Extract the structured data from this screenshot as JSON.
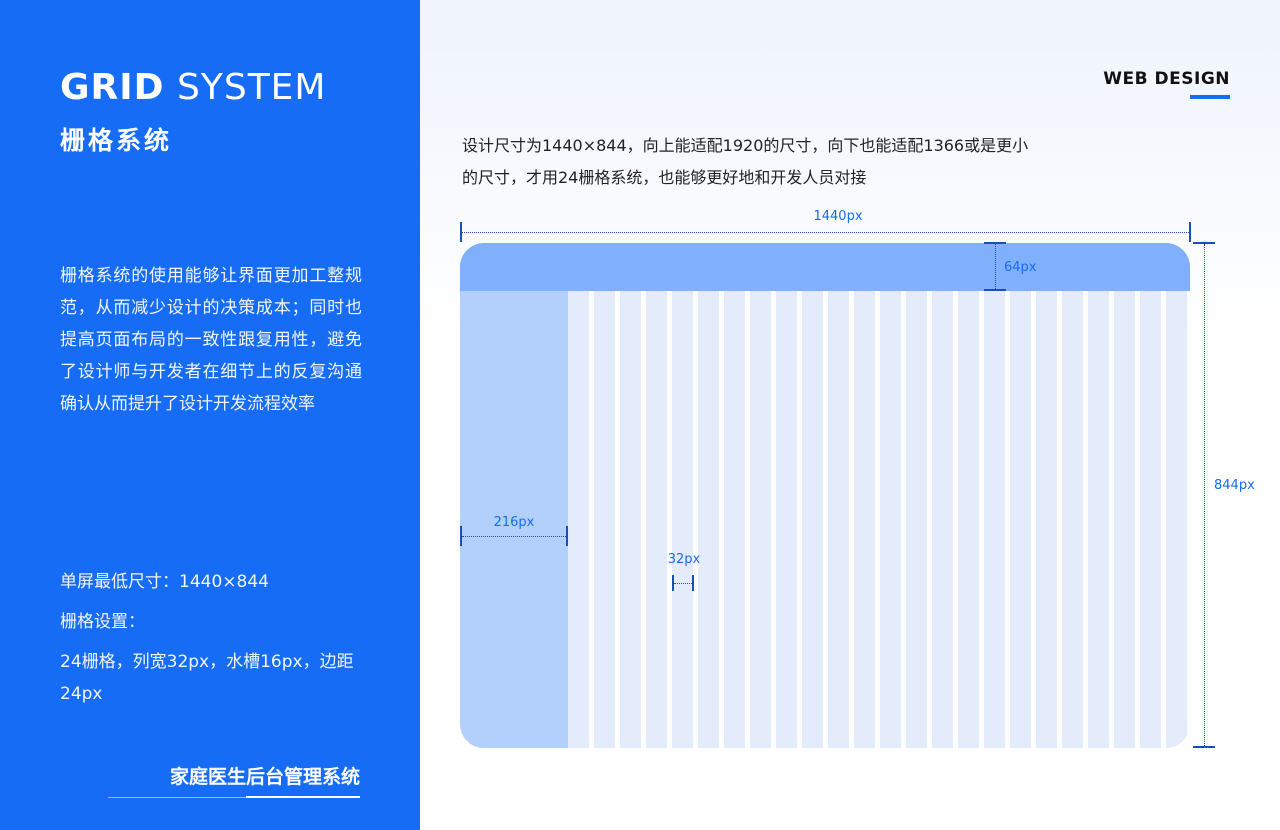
{
  "left_panel": {
    "title_en_bold": "GRID",
    "title_en_thin": "SYSTEM",
    "title_cn": "栅格系统",
    "description": "栅格系统的使用能够让界面更加工整规范，从而减少设计的决策成本；同时也提高页面布局的一致性跟复用性，避免了设计师与开发者在细节上的反复沟通确认从而提升了设计开发流程效率",
    "spec_min_size": "单屏最低尺寸：1440×844",
    "spec_grid_label": "栅格设置：",
    "spec_grid_detail": "24栅格，列宽32px，水槽16px，边距24px",
    "footer_title": "家庭医生后台管理系统"
  },
  "header": {
    "tag": "WEB DESIGN"
  },
  "intro": {
    "line1": "设计尺寸为1440×844，向上能适配1920的尺寸，向下也能适配1366或是更小",
    "line2": "的尺寸，才用24栅格系统，也能够更好地和开发人员对接"
  },
  "diagram": {
    "columns": 24,
    "width_label": "1440px",
    "height_label": "844px",
    "header_height_label": "64px",
    "sidebar_width_label": "216px",
    "column_width_label": "32px"
  },
  "colors": {
    "brand_blue": "#166cf5",
    "header_blue": "#80b0fb",
    "sidebar_blue": "#b3cffc",
    "column_blue": "#e4ecfb"
  }
}
